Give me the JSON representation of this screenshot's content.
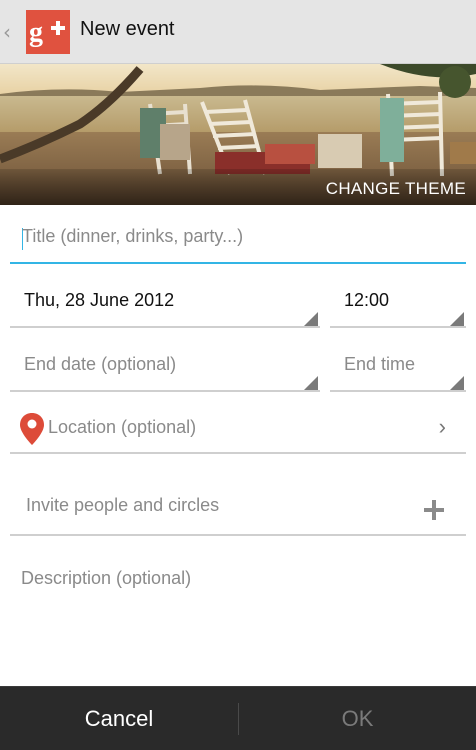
{
  "actionbar": {
    "title": "New event",
    "back_icon": "chevron-left-icon",
    "logo_text": "g+",
    "logo_color": "#e0523f"
  },
  "hero": {
    "change_theme_label": "CHANGE THEME"
  },
  "form": {
    "title_placeholder": "Title (dinner, drinks, party...)",
    "start_date": "Thu, 28 June 2012",
    "start_time": "12:00",
    "end_date_placeholder": "End date (optional)",
    "end_time_placeholder": "End time",
    "location_placeholder": "Location (optional)",
    "invite_placeholder": "Invite people and circles",
    "description_placeholder": "Description (optional)"
  },
  "icons": {
    "location": "map-pin-icon",
    "location_chevron": "chevron-right-icon",
    "invite": "plus-icon"
  },
  "buttons": {
    "cancel": "Cancel",
    "ok": "OK"
  },
  "colors": {
    "accent": "#33b5e5",
    "pin": "#dd4b39",
    "bottom_bar": "#2a2a2a"
  }
}
